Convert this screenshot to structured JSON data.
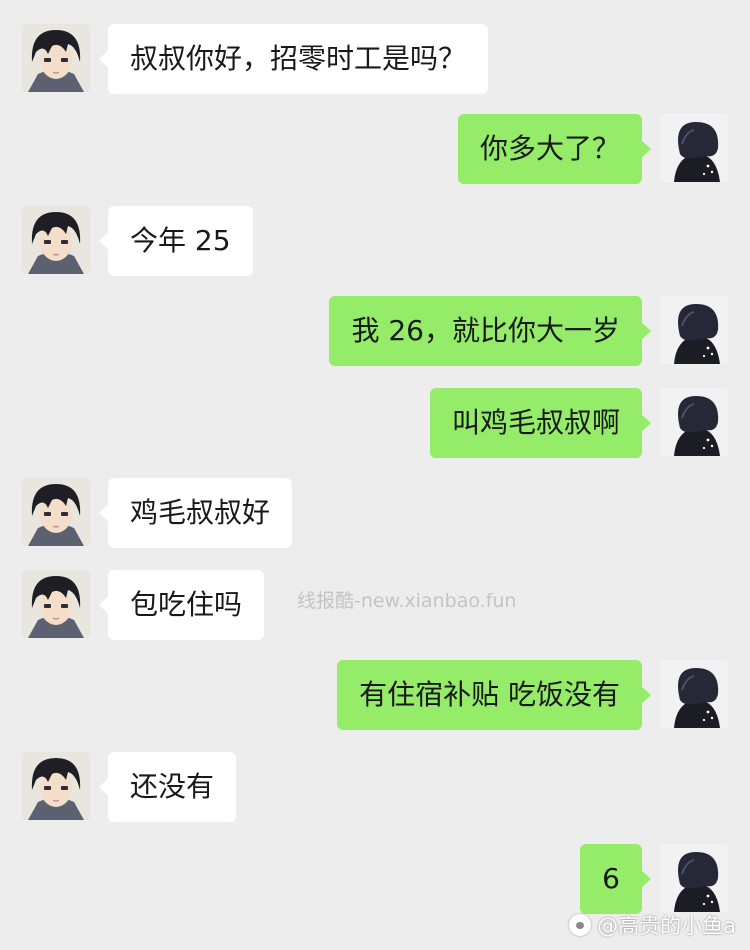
{
  "messages": [
    {
      "side": "left",
      "text": "叔叔你好，招零时工是吗？"
    },
    {
      "side": "right",
      "text": "你多大了？"
    },
    {
      "side": "left",
      "text": "今年 25"
    },
    {
      "side": "right",
      "text": "我 26，就比你大一岁"
    },
    {
      "side": "right",
      "text": "叫鸡毛叔叔啊"
    },
    {
      "side": "left",
      "text": "鸡毛叔叔好"
    },
    {
      "side": "left",
      "text": "包吃住吗"
    },
    {
      "side": "right",
      "text": "有住宿补贴 吃饭没有"
    },
    {
      "side": "left",
      "text": "还没有"
    },
    {
      "side": "right",
      "text": "6"
    }
  ],
  "watermark": "线报酷-new.xianbao.fun",
  "credit": "@高贵的小鱼a",
  "colors": {
    "background": "#ededed",
    "incoming_bubble": "#ffffff",
    "outgoing_bubble": "#95ec69"
  },
  "icons": {
    "incoming_avatar": "anime-boy-avatar",
    "outgoing_avatar": "dark-hair-profile-avatar",
    "credit_icon": "paw-icon"
  }
}
